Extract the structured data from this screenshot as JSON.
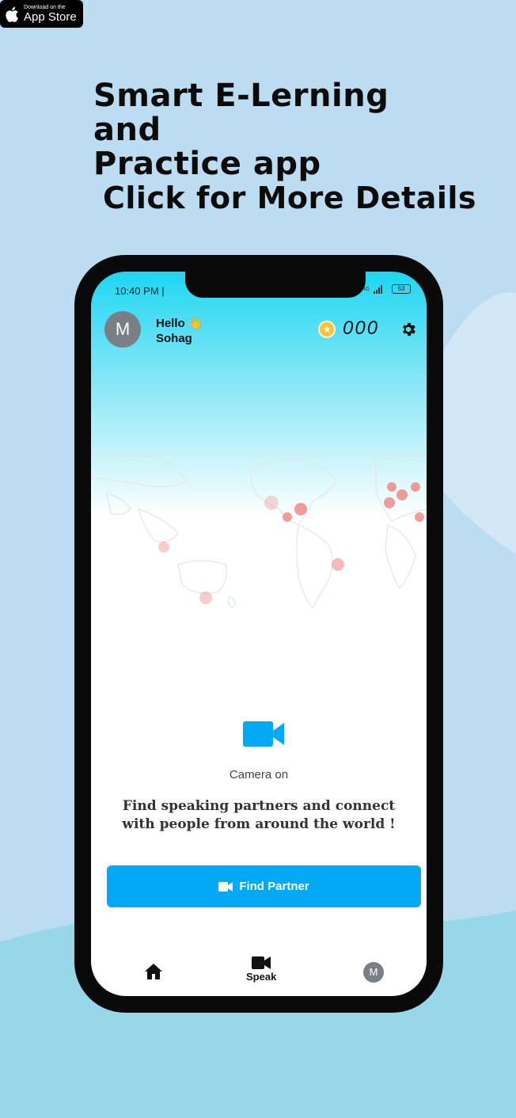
{
  "store_badge": {
    "line1": "Download on the",
    "line2": "App Store"
  },
  "headline": {
    "line1": "Smart E-Lerning and",
    "line2": "Practice app"
  },
  "cta": "Click for More Details",
  "phone": {
    "status": {
      "time": "10:40 PM |",
      "network": "4G",
      "battery": "63"
    },
    "header": {
      "avatar_letter": "M",
      "greeting": "Hello",
      "greeting_emoji": "👋",
      "username": "Sohag",
      "coin_icon": "coin-star-icon",
      "coins": "000",
      "settings_icon": "gear-icon"
    },
    "main": {
      "camera_icon": "video-camera-icon",
      "camera_label": "Camera on",
      "description": "Find speaking partners and connect with people from around the world !",
      "button_label": "Find Partner"
    },
    "nav": {
      "home_icon": "home-icon",
      "speak_label": "Speak",
      "profile_letter": "M"
    }
  },
  "colors": {
    "background": "#bcdcf1",
    "accent": "#03a9f4",
    "header_gradient_top": "#1fd6f2",
    "coin": "#f6c33c"
  }
}
